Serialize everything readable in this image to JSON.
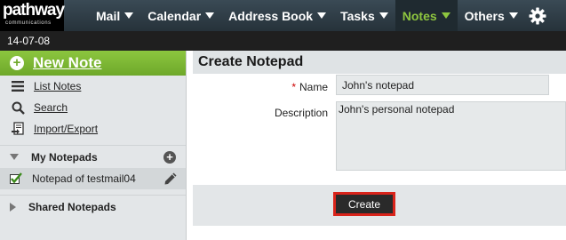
{
  "brand": {
    "line1": "pathway",
    "line2": "communications"
  },
  "nav": {
    "items": [
      {
        "label": "Mail"
      },
      {
        "label": "Calendar"
      },
      {
        "label": "Address Book"
      },
      {
        "label": "Tasks"
      },
      {
        "label": "Notes",
        "active": true
      },
      {
        "label": "Others"
      }
    ],
    "active_color": "#8ec63f"
  },
  "date": "14-07-08",
  "sidebar": {
    "new_note": "New Note",
    "links": [
      {
        "label": "List Notes",
        "icon": "list-icon"
      },
      {
        "label": "Search",
        "icon": "search-icon"
      },
      {
        "label": "Import/Export",
        "icon": "import-export-icon"
      }
    ],
    "my_notepads": {
      "title": "My Notepads",
      "items": [
        {
          "label": "Notepad of testmail04"
        }
      ]
    },
    "shared_notepads": {
      "title": "Shared Notepads"
    }
  },
  "main": {
    "title": "Create Notepad",
    "form": {
      "required_mark": "*",
      "name_label": "Name",
      "name_value": "John's notepad",
      "description_label": "Description",
      "description_value": "John's personal notepad"
    },
    "create_label": "Create"
  }
}
